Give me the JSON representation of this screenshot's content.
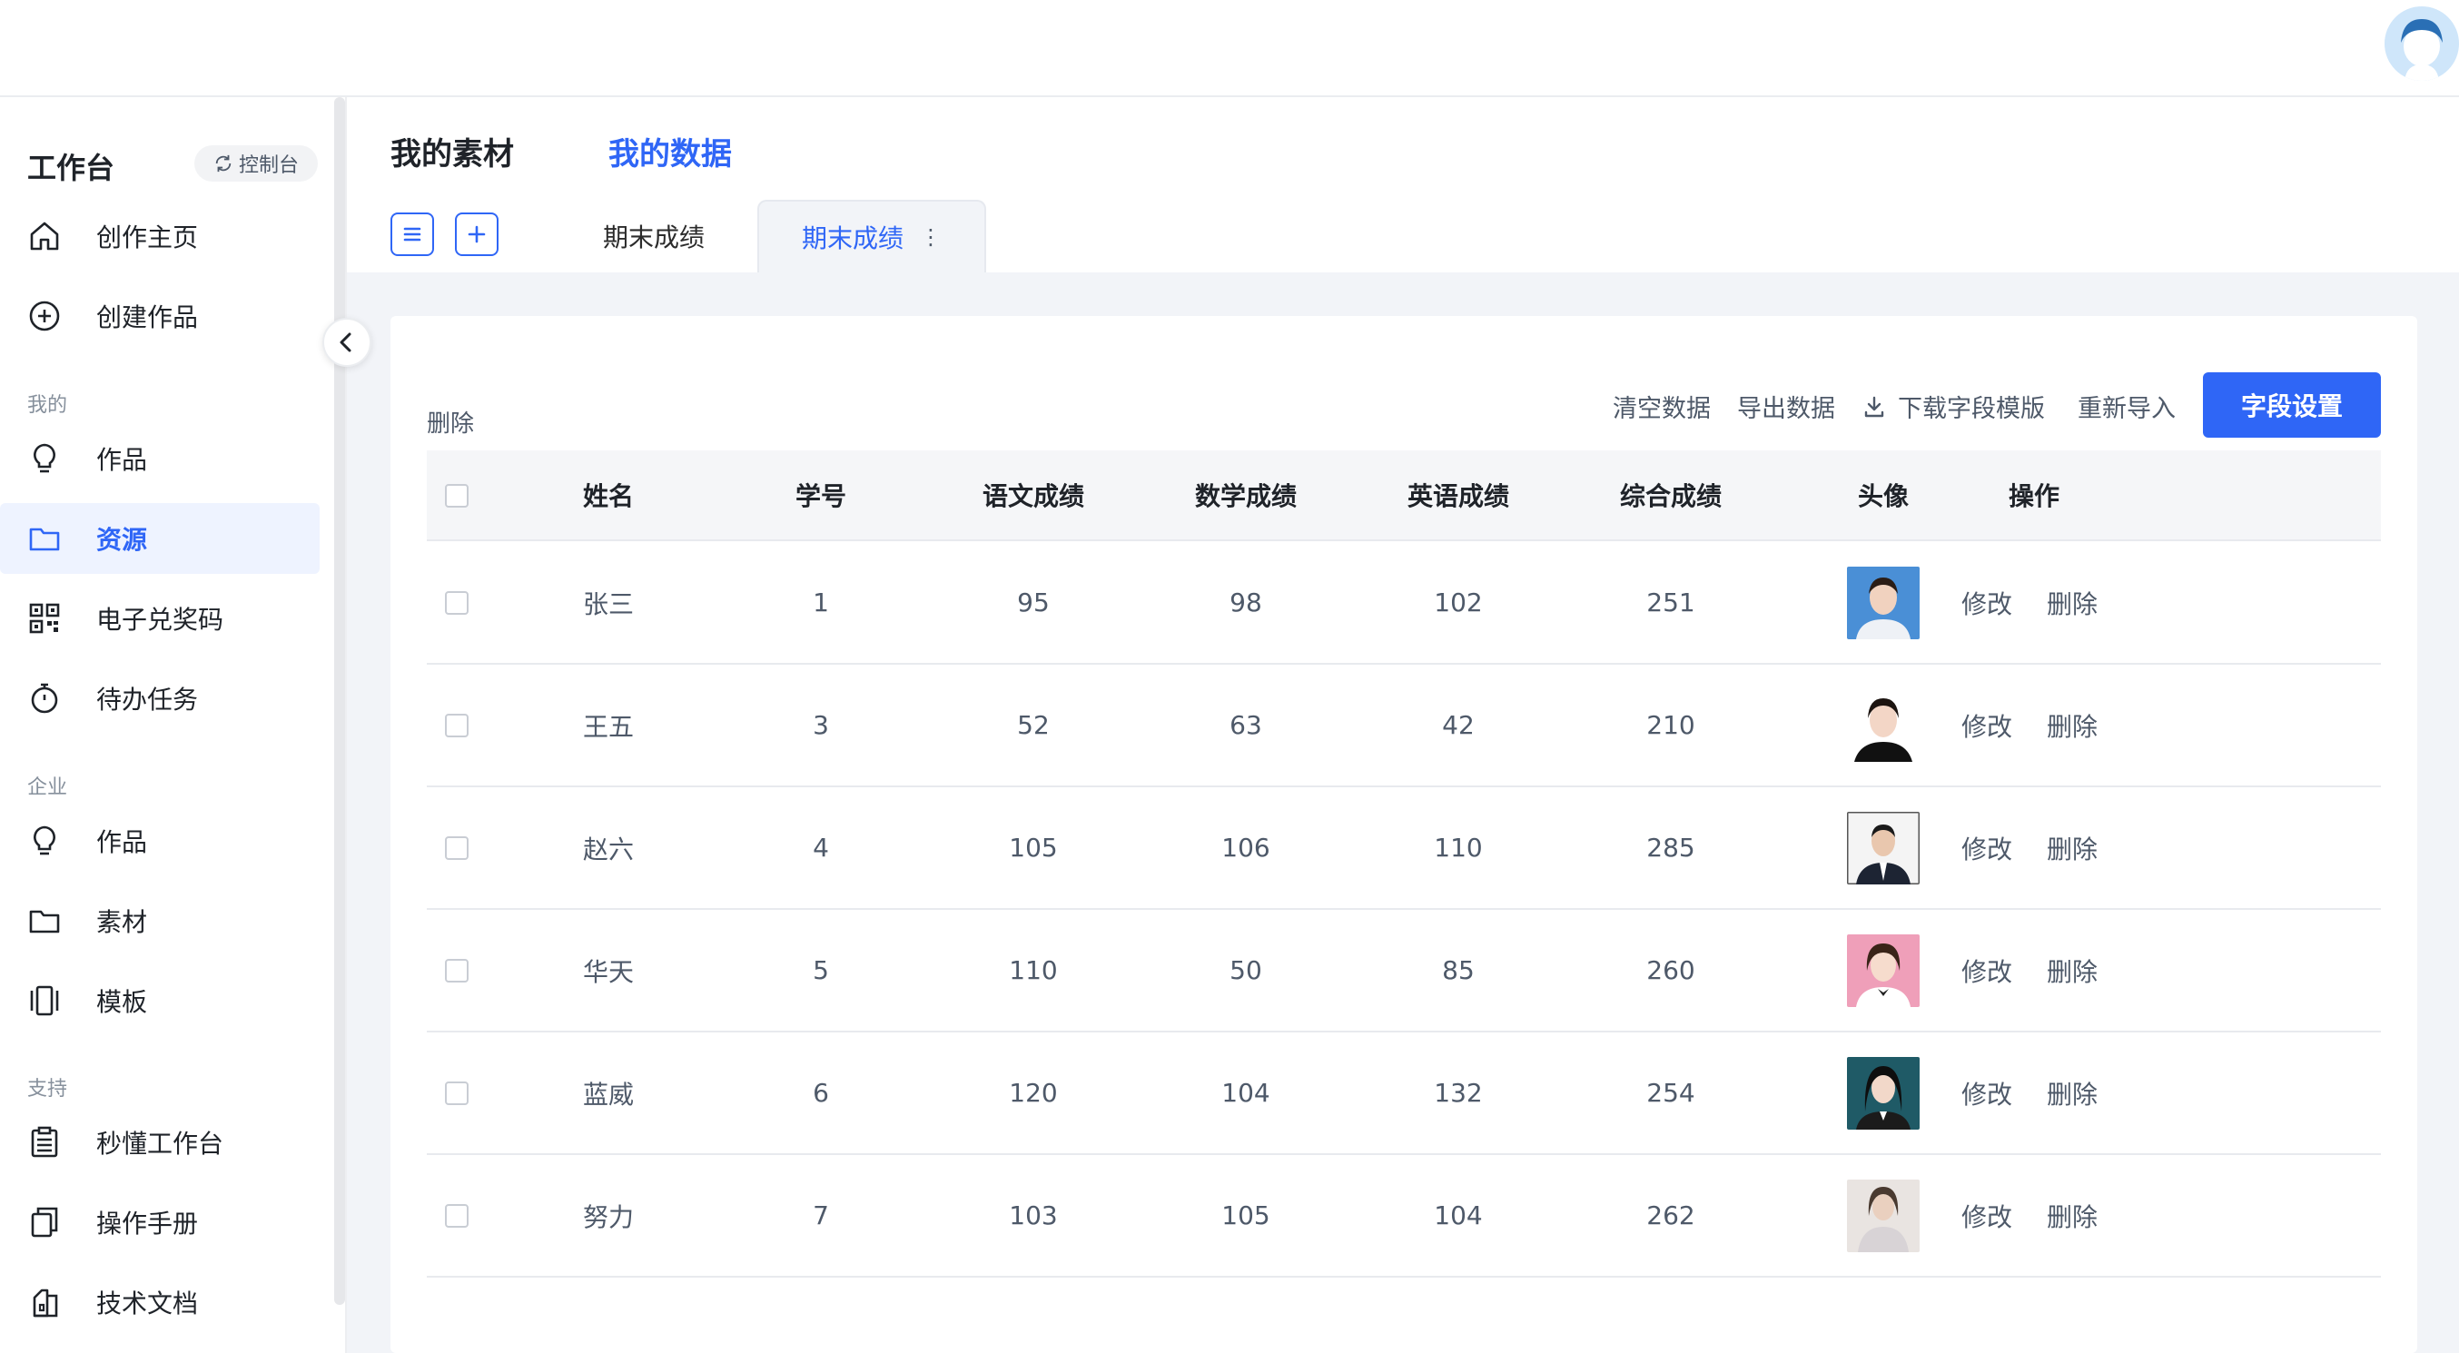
{
  "sidebar": {
    "title": "工作台",
    "console_label": "控制台",
    "items_top": [
      {
        "label": "创作主页",
        "icon": "home-icon"
      },
      {
        "label": "创建作品",
        "icon": "plus-circle-icon"
      }
    ],
    "section_mine": "我的",
    "items_mine": [
      {
        "label": "作品",
        "icon": "lightbulb-icon"
      },
      {
        "label": "资源",
        "icon": "folder-icon",
        "active": true
      },
      {
        "label": "电子兑奖码",
        "icon": "qrcode-icon"
      },
      {
        "label": "待办任务",
        "icon": "stopwatch-icon"
      }
    ],
    "section_enterprise": "企业",
    "items_enterprise": [
      {
        "label": "作品",
        "icon": "lightbulb-icon"
      },
      {
        "label": "素材",
        "icon": "folder-icon"
      },
      {
        "label": "模板",
        "icon": "template-icon"
      }
    ],
    "section_support": "支持",
    "items_support": [
      {
        "label": "秒懂工作台",
        "icon": "clipboard-icon"
      },
      {
        "label": "操作手册",
        "icon": "manual-icon"
      },
      {
        "label": "技术文档",
        "icon": "document-icon"
      }
    ]
  },
  "main": {
    "tabs": [
      {
        "label": "我的素材",
        "active": false
      },
      {
        "label": "我的数据",
        "active": true
      }
    ],
    "sheet_tabs": [
      {
        "label": "期末成绩",
        "active": false
      },
      {
        "label": "期末成绩",
        "active": true
      }
    ],
    "toolbar": {
      "delete_label": "删除",
      "clear_label": "清空数据",
      "export_label": "导出数据",
      "download_label": "下载字段模版",
      "reimport_label": "重新导入",
      "field_settings_label": "字段设置"
    },
    "table": {
      "columns": [
        "姓名",
        "学号",
        "语文成绩",
        "数学成绩",
        "英语成绩",
        "综合成绩",
        "头像",
        "操作"
      ],
      "edit_label": "修改",
      "delete_label": "删除",
      "rows": [
        {
          "name": "张三",
          "id": "1",
          "chinese": "95",
          "math": "98",
          "english": "102",
          "total": "251"
        },
        {
          "name": "王五",
          "id": "3",
          "chinese": "52",
          "math": "63",
          "english": "42",
          "total": "210"
        },
        {
          "name": "赵六",
          "id": "4",
          "chinese": "105",
          "math": "106",
          "english": "110",
          "total": "285"
        },
        {
          "name": "华天",
          "id": "5",
          "chinese": "110",
          "math": "50",
          "english": "85",
          "total": "260"
        },
        {
          "name": "蓝威",
          "id": "6",
          "chinese": "120",
          "math": "104",
          "english": "132",
          "total": "254"
        },
        {
          "name": "努力",
          "id": "7",
          "chinese": "103",
          "math": "105",
          "english": "104",
          "total": "262"
        }
      ]
    }
  },
  "colors": {
    "accent": "#2f66f6",
    "active_bg": "#eef3ff",
    "text_primary": "#1f2329",
    "text_secondary": "#4e5969"
  }
}
